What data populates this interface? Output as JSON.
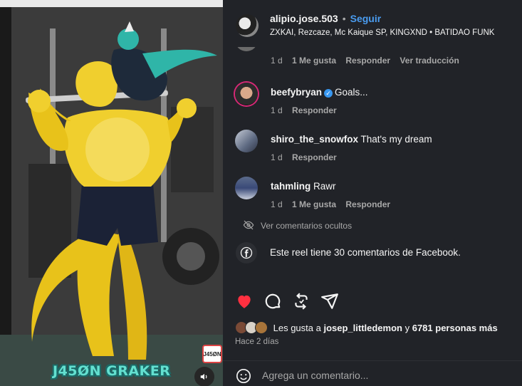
{
  "media": {
    "watermark": "J45ØN GRAKER",
    "logo_text": "J45ØN",
    "mute_icon": "speaker-icon"
  },
  "post": {
    "username": "alipio.jose.503",
    "dot": "•",
    "follow_label": "Seguir",
    "music": "ZXKAI, Rezcaze, Mc Kaique SP, KINGXND • BATIDAO FUNK"
  },
  "comments": [
    {
      "username": "",
      "text": "",
      "time": "1 d",
      "likes": "1 Me gusta",
      "reply": "Responder",
      "translate": "Ver traducción"
    },
    {
      "username": "beefybryan",
      "verified": true,
      "text": "Goals...",
      "time": "1 d",
      "reply": "Responder"
    },
    {
      "username": "shiro_the_snowfox",
      "text": "That's my dream",
      "time": "1 d",
      "reply": "Responder"
    },
    {
      "username": "tahmling",
      "text": "Rawr",
      "time": "1 d",
      "likes": "1 Me gusta",
      "reply": "Responder"
    }
  ],
  "hidden_comments": "Ver comentarios ocultos",
  "facebook_note": "Este reel tiene 30 comentarios de Facebook.",
  "likes": {
    "prefix": "Les gusta a ",
    "user": "josep_littledemon",
    "middle": " y ",
    "others": "6781 personas más"
  },
  "time_ago": "Hace 2 días",
  "compose": {
    "placeholder": "Agrega un comentario..."
  },
  "colors": {
    "accent": "#4a9cf0",
    "like_red": "#ff3040",
    "panel_bg": "#212328",
    "watermark": "#63e0d0"
  }
}
